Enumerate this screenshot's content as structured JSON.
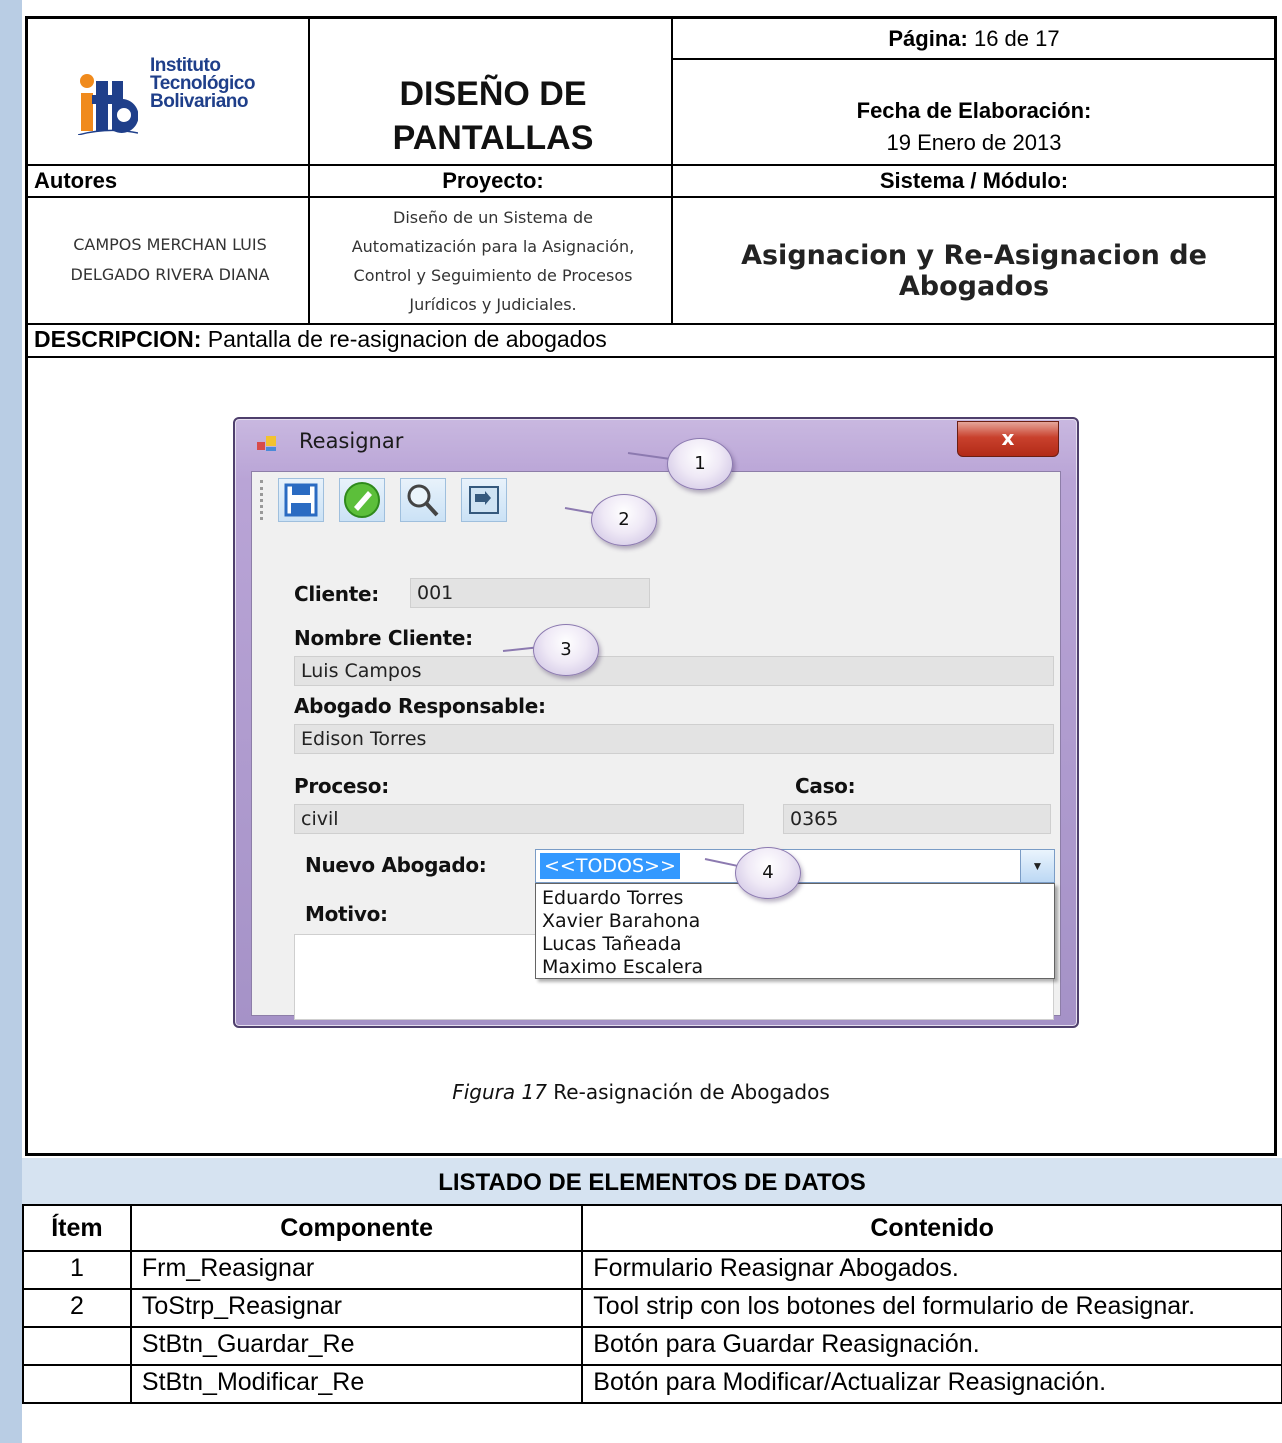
{
  "header": {
    "logo": {
      "line1": "Instituto",
      "line2": "Tecnológico",
      "line3": "Bolivariano",
      "mark": "itb"
    },
    "title_line1": "DISEÑO DE",
    "title_line2": "PANTALLAS",
    "pagina_label": "Página:",
    "pagina_value": "16 de 17",
    "fecha_label": "Fecha de Elaboración:",
    "fecha_value": "19 Enero de 2013",
    "autores_label": "Autores",
    "proyecto_label": "Proyecto:",
    "sistema_label": "Sistema / Módulo:",
    "autor1": "CAMPOS MERCHAN LUIS",
    "autor2": "DELGADO RIVERA DIANA",
    "proyecto_line1": "Diseño de un Sistema de",
    "proyecto_line2": "Automatización para la Asignación,",
    "proyecto_line3": "Control y Seguimiento de Procesos",
    "proyecto_line4": "Jurídicos y Judiciales.",
    "modulo": "Asignacion y Re-Asignacion de Abogados",
    "descripcion_label": "DESCRIPCION:",
    "descripcion_value": "Pantalla de re-asignacion de abogados"
  },
  "window": {
    "title": "Reasignar",
    "close": "x",
    "toolbar_icons": [
      "save-icon",
      "edit-icon",
      "search-icon",
      "exit-icon"
    ],
    "cliente_label": "Cliente:",
    "cliente_value": "001",
    "nombre_label": "Nombre Cliente:",
    "nombre_value": "Luis Campos",
    "abogado_label": "Abogado Responsable:",
    "abogado_value": "Edison Torres",
    "proceso_label": "Proceso:",
    "proceso_value": "civil",
    "caso_label": "Caso:",
    "caso_value": "0365",
    "nuevo_label": "Nuevo Abogado:",
    "nuevo_selected": "<<TODOS>>",
    "motivo_label": "Motivo:",
    "dropdown_options": [
      "Eduardo Torres",
      "Xavier Barahona",
      "Lucas Tañeada",
      "Maximo Escalera"
    ]
  },
  "callouts": [
    "1",
    "2",
    "3",
    "4"
  ],
  "caption": {
    "figure": "Figura 17",
    "text": "Re-asignación de Abogados"
  },
  "table": {
    "title": "LISTADO DE ELEMENTOS DE DATOS",
    "headers": [
      "Ítem",
      "Componente",
      "Contenido"
    ],
    "rows": [
      {
        "item": "1",
        "componente": "Frm_Reasignar",
        "contenido": "Formulario Reasignar Abogados."
      },
      {
        "item": "2",
        "componente": "ToStrp_Reasignar",
        "contenido": "Tool strip con los botones del formulario de Reasignar."
      },
      {
        "item": "",
        "componente": "StBtn_Guardar_Re",
        "contenido": "Botón para Guardar Reasignación."
      },
      {
        "item": "",
        "componente": "StBtn_Modificar_Re",
        "contenido": "Botón para Modificar/Actualizar Reasignación."
      }
    ]
  },
  "colors": {
    "side_rule": "#b9cde4",
    "table_title_bg": "#d6e3f1",
    "logo_blue": "#1f3f8a",
    "logo_orange": "#f08a1c",
    "selection": "#3399ff"
  }
}
